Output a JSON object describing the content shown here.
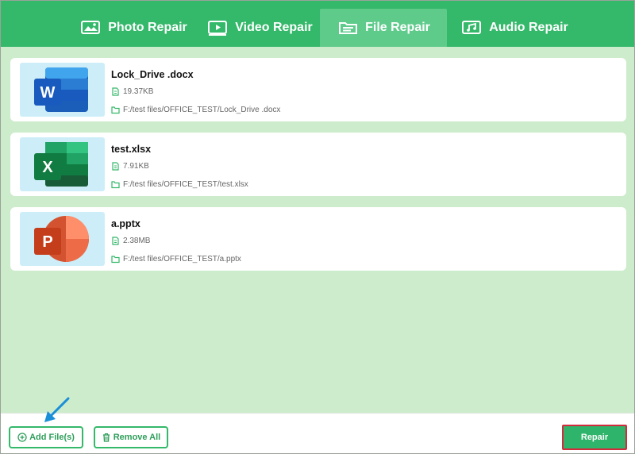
{
  "tabs": [
    {
      "label": "Photo Repair",
      "icon": "photo-icon",
      "active": false
    },
    {
      "label": "Video Repair",
      "icon": "video-icon",
      "active": false
    },
    {
      "label": "File Repair",
      "icon": "file-icon",
      "active": true
    },
    {
      "label": "Audio Repair",
      "icon": "audio-icon",
      "active": false
    }
  ],
  "files": [
    {
      "name": "Lock_Drive .docx",
      "size": "19.37KB",
      "path": "F:/test files/OFFICE_TEST/Lock_Drive .docx",
      "icon": "word-icon",
      "letter": "W"
    },
    {
      "name": "test.xlsx",
      "size": "7.91KB",
      "path": "F:/test files/OFFICE_TEST/test.xlsx",
      "icon": "excel-icon",
      "letter": "X"
    },
    {
      "name": "a.pptx",
      "size": "2.38MB",
      "path": "F:/test files/OFFICE_TEST/a.pptx",
      "icon": "powerpoint-icon",
      "letter": "P"
    }
  ],
  "bottom": {
    "add_label": "Add File(s)",
    "remove_label": "Remove All",
    "repair_label": "Repair"
  },
  "colors": {
    "header": "#34b86a",
    "active_tab": "#5ecb8b",
    "background": "#cdeccb",
    "accent": "#2fb46b",
    "highlight": "#d22b3c",
    "arrow": "#1a8fd8"
  }
}
